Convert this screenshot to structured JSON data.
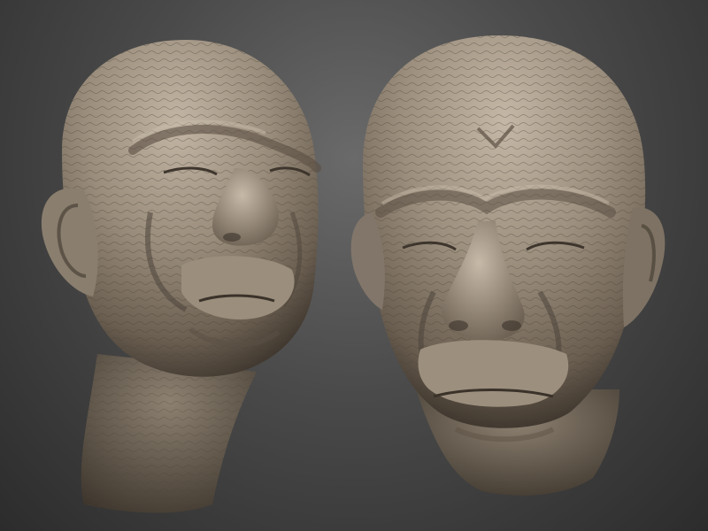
{
  "scene": {
    "background_top": "#6a6a6a",
    "background_bottom": "#2c2c2c",
    "clay_light": "#b7aa9a",
    "clay_mid": "#8f8373",
    "clay_dark": "#4f463c",
    "clay_shadow": "#2f2a24"
  },
  "heads": [
    {
      "view": "three-quarter-left"
    },
    {
      "view": "front"
    }
  ]
}
